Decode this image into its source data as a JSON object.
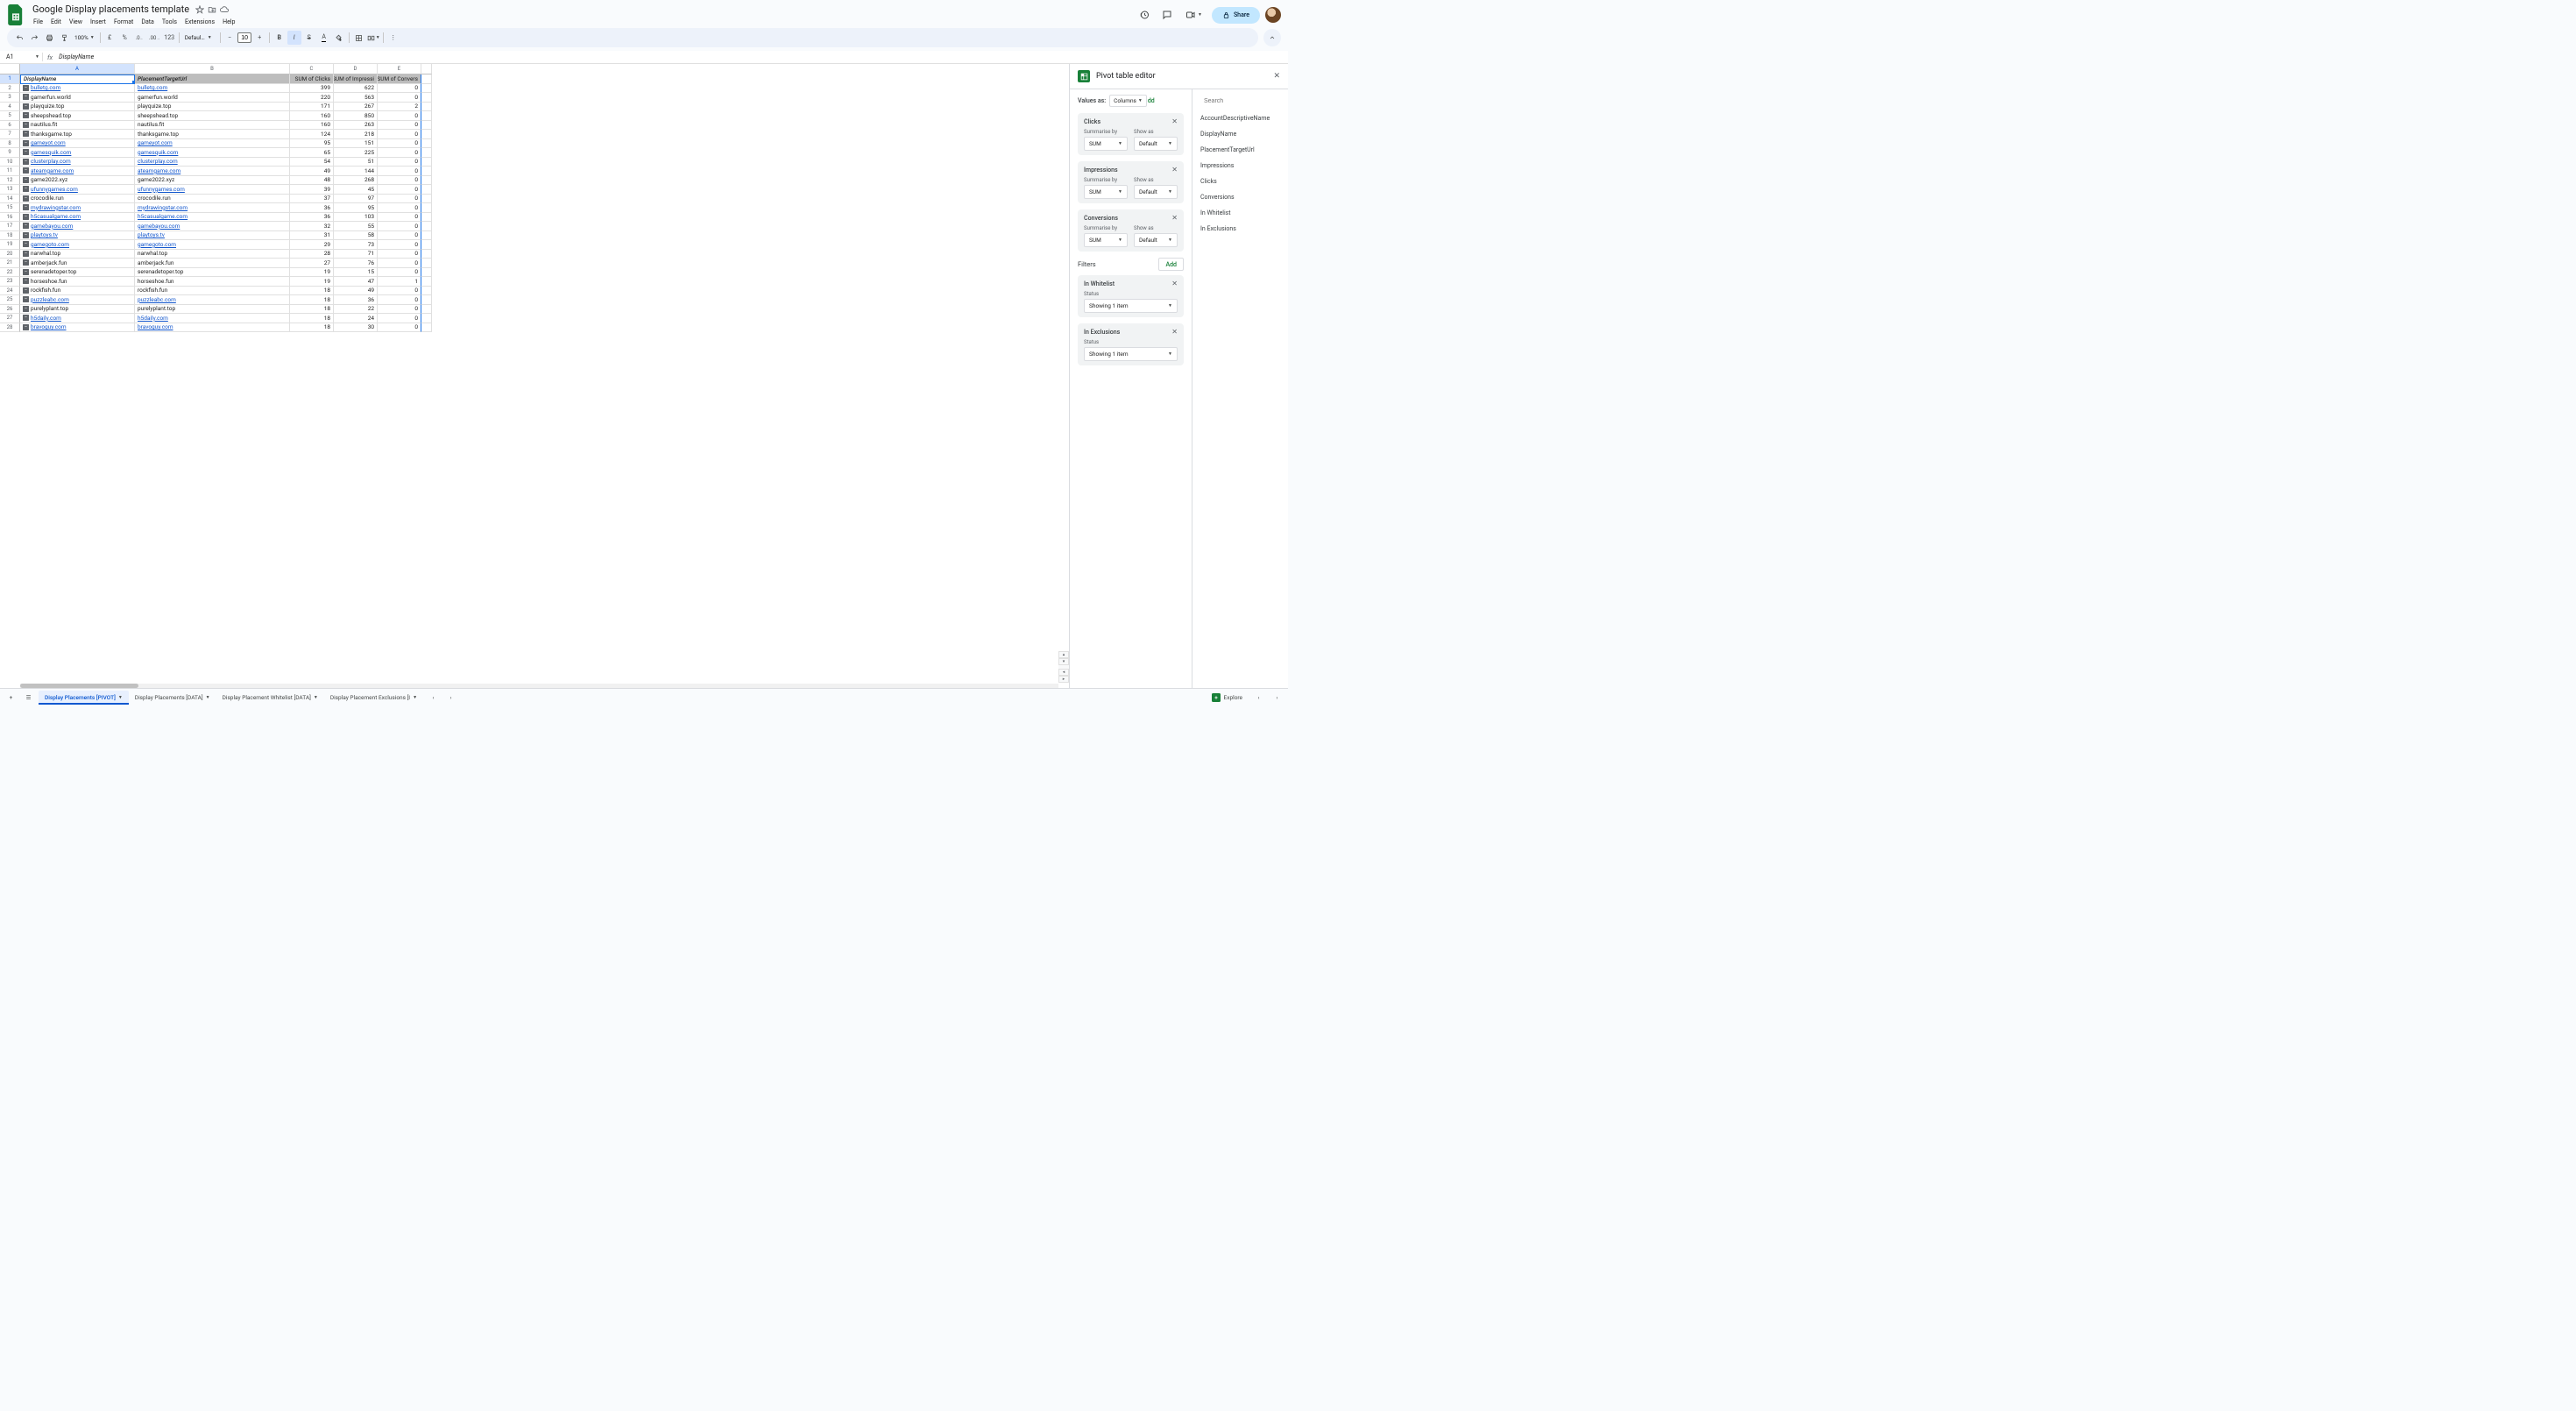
{
  "doc_title": "Google Display placements template",
  "menu": [
    "File",
    "Edit",
    "View",
    "Insert",
    "Format",
    "Data",
    "Tools",
    "Extensions",
    "Help"
  ],
  "toolbar": {
    "zoom": "100%",
    "font": "Defaul…",
    "font_size": "10",
    "num_label": "123"
  },
  "name_box": "A1",
  "formula": "DisplayName",
  "share_label": "Share",
  "columns": [
    "A",
    "B",
    "C",
    "D",
    "E"
  ],
  "header_row": [
    "DisplayName",
    "PlacementTargetUrl",
    "SUM of Clicks",
    "SUM of Impressi",
    "SUM of Convers"
  ],
  "rows": [
    {
      "a": "bulletg.com",
      "b": "bulletg.com",
      "c": "399",
      "d": "622",
      "e": "0",
      "al": true,
      "bl": true
    },
    {
      "a": "gamerfun.world",
      "b": "gamerfun.world",
      "c": "220",
      "d": "563",
      "e": "0",
      "al": false,
      "bl": false
    },
    {
      "a": "playquize.top",
      "b": "playquize.top",
      "c": "171",
      "d": "267",
      "e": "2",
      "al": false,
      "bl": false
    },
    {
      "a": "sheepshead.top",
      "b": "sheepshead.top",
      "c": "160",
      "d": "850",
      "e": "0",
      "al": false,
      "bl": false
    },
    {
      "a": "nautilus.fit",
      "b": "nautilus.fit",
      "c": "160",
      "d": "263",
      "e": "0",
      "al": false,
      "bl": false
    },
    {
      "a": "thanksgame.top",
      "b": "thanksgame.top",
      "c": "124",
      "d": "218",
      "e": "0",
      "al": false,
      "bl": false
    },
    {
      "a": "gameyot.com",
      "b": "gameyot.com",
      "c": "95",
      "d": "151",
      "e": "0",
      "al": true,
      "bl": true
    },
    {
      "a": "gamesquik.com",
      "b": "gamesquik.com",
      "c": "65",
      "d": "225",
      "e": "0",
      "al": true,
      "bl": true
    },
    {
      "a": "clusterplay.com",
      "b": "clusterplay.com",
      "c": "54",
      "d": "51",
      "e": "0",
      "al": true,
      "bl": true
    },
    {
      "a": "ateamgame.com",
      "b": "ateamgame.com",
      "c": "49",
      "d": "144",
      "e": "0",
      "al": true,
      "bl": true
    },
    {
      "a": "game2022.xyz",
      "b": "game2022.xyz",
      "c": "48",
      "d": "268",
      "e": "0",
      "al": false,
      "bl": false
    },
    {
      "a": "ufunnygames.com",
      "b": "ufunnygames.com",
      "c": "39",
      "d": "45",
      "e": "0",
      "al": true,
      "bl": true
    },
    {
      "a": "crocodile.run",
      "b": "crocodile.run",
      "c": "37",
      "d": "97",
      "e": "0",
      "al": false,
      "bl": false
    },
    {
      "a": "mydrawingstar.com",
      "b": "mydrawingstar.com",
      "c": "36",
      "d": "95",
      "e": "0",
      "al": true,
      "bl": true
    },
    {
      "a": "h5casualgame.com",
      "b": "h5casualgame.com",
      "c": "36",
      "d": "103",
      "e": "0",
      "al": true,
      "bl": true
    },
    {
      "a": "gamebayou.com",
      "b": "gamebayou.com",
      "c": "32",
      "d": "55",
      "e": "0",
      "al": true,
      "bl": true
    },
    {
      "a": "playtoys.tv",
      "b": "playtoys.tv",
      "c": "31",
      "d": "58",
      "e": "0",
      "al": true,
      "bl": true
    },
    {
      "a": "gamegoto.com",
      "b": "gamegoto.com",
      "c": "29",
      "d": "73",
      "e": "0",
      "al": true,
      "bl": true
    },
    {
      "a": "narwhal.top",
      "b": "narwhal.top",
      "c": "28",
      "d": "71",
      "e": "0",
      "al": false,
      "bl": false
    },
    {
      "a": "amberjack.fun",
      "b": "amberjack.fun",
      "c": "27",
      "d": "76",
      "e": "0",
      "al": false,
      "bl": false
    },
    {
      "a": "serenadetoper.top",
      "b": "serenadetoper.top",
      "c": "19",
      "d": "15",
      "e": "0",
      "al": false,
      "bl": false
    },
    {
      "a": "horseshoe.fun",
      "b": "horseshoe.fun",
      "c": "19",
      "d": "47",
      "e": "1",
      "al": false,
      "bl": false
    },
    {
      "a": "rockfish.fun",
      "b": "rockfish.fun",
      "c": "18",
      "d": "49",
      "e": "0",
      "al": false,
      "bl": false
    },
    {
      "a": "puzzleabc.com",
      "b": "puzzleabc.com",
      "c": "18",
      "d": "36",
      "e": "0",
      "al": true,
      "bl": true
    },
    {
      "a": "purelyplant.top",
      "b": "purelyplant.top",
      "c": "18",
      "d": "22",
      "e": "0",
      "al": false,
      "bl": false
    },
    {
      "a": "h5daily.com",
      "b": "h5daily.com",
      "c": "18",
      "d": "24",
      "e": "0",
      "al": true,
      "bl": true
    },
    {
      "a": "bravoguy.com",
      "b": "bravoguy.com",
      "c": "18",
      "d": "30",
      "e": "0",
      "al": true,
      "bl": true
    }
  ],
  "pivot": {
    "title": "Pivot table editor",
    "values_as_label": "Values as:",
    "values_as_value": "Columns",
    "add_label_partial": "dd",
    "chips": [
      {
        "name": "Clicks",
        "summ_label": "Summarise by",
        "summ_val": "SUM",
        "show_label": "Show as",
        "show_val": "Default"
      },
      {
        "name": "Impressions",
        "summ_label": "Summarise by",
        "summ_val": "SUM",
        "show_label": "Show as",
        "show_val": "Default"
      },
      {
        "name": "Conversions",
        "summ_label": "Summarise by",
        "summ_val": "SUM",
        "show_label": "Show as",
        "show_val": "Default"
      }
    ],
    "filters_label": "Filters",
    "add_btn": "Add",
    "filter_chips": [
      {
        "name": "In Whitelist",
        "status_label": "Status",
        "status_val": "Showing 1 item"
      },
      {
        "name": "In Exclusions",
        "status_label": "Status",
        "status_val": "Showing 1 item"
      }
    ],
    "search_placeholder": "Search",
    "fields": [
      "AccountDescriptiveName",
      "DisplayName",
      "PlacementTargetUrl",
      "Impressions",
      "Clicks",
      "Conversions",
      "In Whitelist",
      "In Exclusions"
    ]
  },
  "sheet_tabs": [
    "Display Placements [PIVOT]",
    "Display Placements [DATA]",
    "Display Placement Whitelist [DATA]",
    "Display Placement Exclusions [I"
  ],
  "explore_label": "Explore"
}
